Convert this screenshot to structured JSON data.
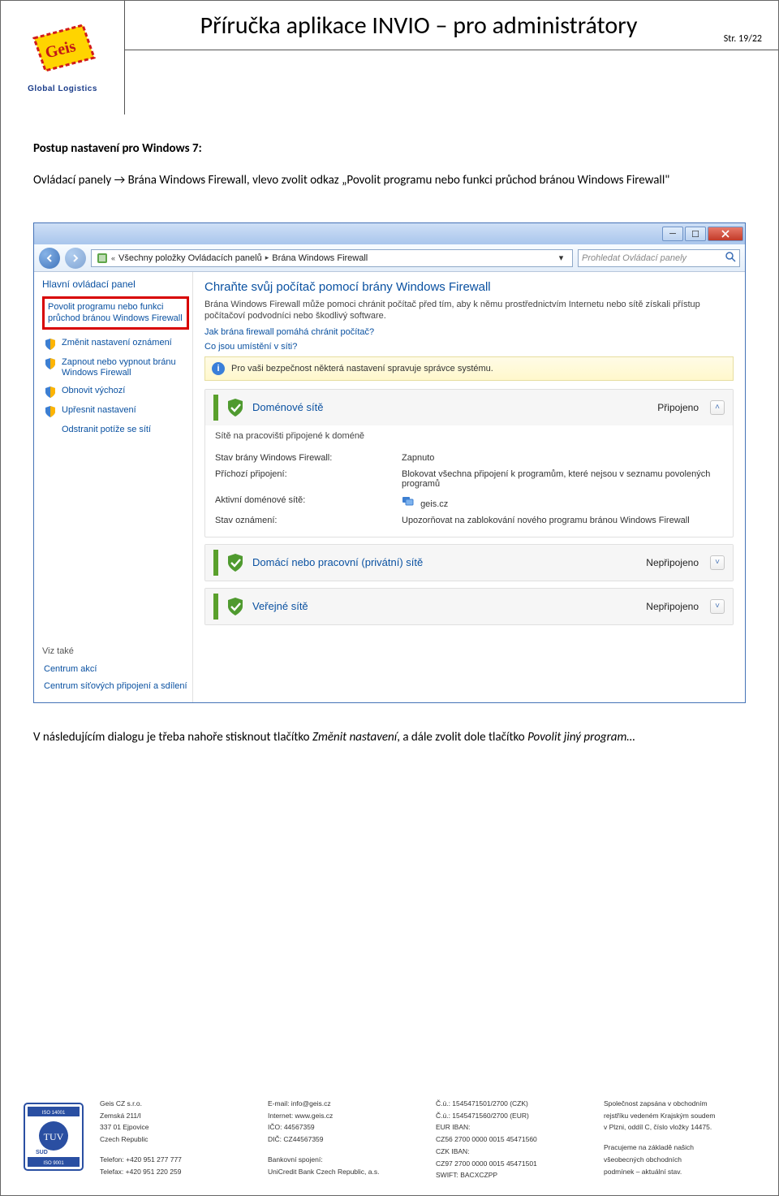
{
  "header": {
    "logo_subtitle": "Global Logistics",
    "doc_title": "Příručka aplikace INVIO – pro administrátory",
    "page_number": "Str. 19/22"
  },
  "body": {
    "heading": "Postup nastavení pro Windows 7:",
    "para1_pre": "Ovládací panely ",
    "para1_link": "→ Brána Windows Firewall, vlevo zvolit odkaz „Povolit programu nebo funkci průchod bránou Windows Firewall\"",
    "para2_pre": "V následujícím dialogu je třeba nahoře stisknout tlačítko ",
    "para2_em1": "Změnit nastavení",
    "para2_mid": ", a dále zvolit dole tlačítko ",
    "para2_em2": "Povolit jiný program…"
  },
  "screenshot": {
    "breadcrumb": {
      "l1": "Všechny položky Ovládacích panelů",
      "l2": "Brána Windows Firewall"
    },
    "search_placeholder": "Prohledat Ovládací panely",
    "sidebar": {
      "title": "Hlavní ovládací panel",
      "highlighted": "Povolit programu nebo funkci průchod bránou Windows Firewall",
      "items": [
        "Změnit nastavení oznámení",
        "Zapnout nebo vypnout bránu Windows Firewall",
        "Obnovit výchozí",
        "Upřesnit nastavení",
        "Odstranit potíže se sítí"
      ],
      "see_also_title": "Viz také",
      "see_also": [
        "Centrum akcí",
        "Centrum síťových připojení a sdílení"
      ]
    },
    "main": {
      "heading": "Chraňte svůj počítač pomocí brány Windows Firewall",
      "subtext": "Brána Windows Firewall může pomoci chránit počítač před tím, aby k němu prostřednictvím Internetu nebo sítě získali přístup počítačoví podvodníci nebo škodlivý software.",
      "link1": "Jak brána firewall pomáhá chránit počítač?",
      "link2": "Co jsou umístění v síti?",
      "alert": "Pro vaši bezpečnost některá nastavení spravuje správce systému.",
      "groups": [
        {
          "name": "Doménové sítě",
          "status": "Připojeno",
          "expanded": true,
          "body_caption": "Sítě na pracovišti připojené k doméně",
          "rows": [
            {
              "k": "Stav brány Windows Firewall:",
              "v": "Zapnuto"
            },
            {
              "k": "Příchozí připojení:",
              "v": "Blokovat všechna připojení k programům, které nejsou v seznamu povolených programů"
            },
            {
              "k": "Aktivní doménové sítě:",
              "v": "geis.cz",
              "icon": "site-icon"
            },
            {
              "k": "Stav oznámení:",
              "v": "Upozorňovat na zablokování nového programu bránou Windows Firewall"
            }
          ]
        },
        {
          "name": "Domácí nebo pracovní (privátní) sítě",
          "status": "Nepřipojeno",
          "expanded": false
        },
        {
          "name": "Veřejné sítě",
          "status": "Nepřipojeno",
          "expanded": false
        }
      ]
    }
  },
  "footer": {
    "col1": [
      "Geis CZ s.r.o.",
      "Zemská 211/I",
      "337 01 Ejpovice",
      "Czech Republic",
      "",
      "Telefon: +420 951 277 777",
      "Telefax: +420 951 220 259"
    ],
    "col2": [
      "E-mail: info@geis.cz",
      "Internet: www.geis.cz",
      "IČO: 44567359",
      "DIČ: CZ44567359",
      "",
      "Bankovní spojení:",
      "UniCredit Bank Czech Republic, a.s."
    ],
    "col3": [
      "Č.ú.: 1545471501/2700 (CZK)",
      "Č.ú.: 1545471560/2700 (EUR)",
      "EUR IBAN:",
      "CZ56 2700 0000 0015 45471560",
      "CZK IBAN:",
      "CZ97 2700 0000 0015 45471501",
      "SWIFT: BACXCZPP"
    ],
    "col4": [
      "Společnost zapsána v obchodním",
      "rejstříku vedeném Krajským soudem",
      "v Plzni, oddíl C, číslo vložky 14475.",
      "",
      "Pracujeme na základě našich",
      "všeobecných obchodních",
      "podmínek – aktuální stav."
    ]
  }
}
